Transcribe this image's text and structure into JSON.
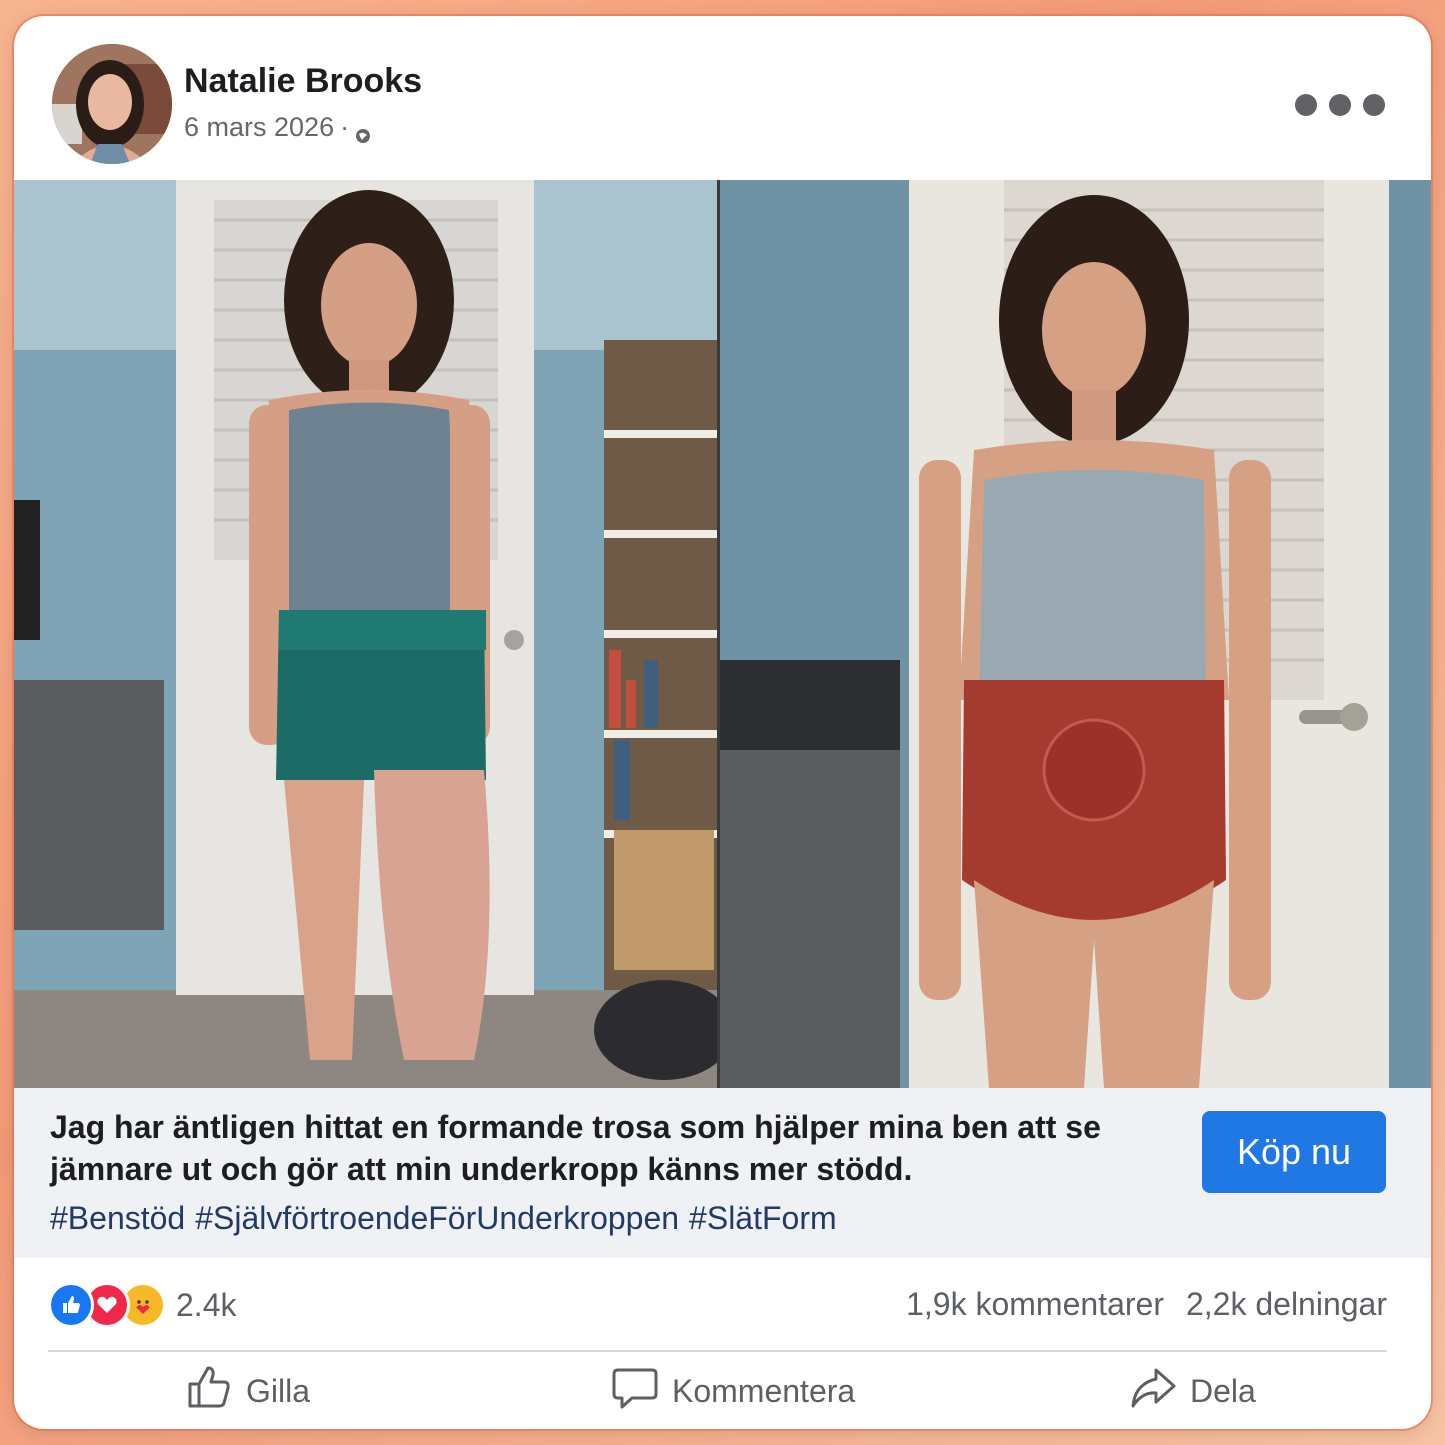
{
  "post": {
    "author": "Natalie Brooks",
    "date": "6 mars 2026",
    "separator": "·",
    "caption": "Jag har äntligen hittat en formande trosa som hjälper mina ben att se jämnare ut och gör att min underkropp känns mer stödd.",
    "hashtags": [
      "#Benstöd",
      "#SjälvförtroendeFörUnderkroppen",
      "#SlätForm"
    ],
    "cta_label": "Köp nu"
  },
  "stats": {
    "reaction_count": "2.4k",
    "comments": "1,9k kommentarer",
    "shares": "2,2k delningar"
  },
  "actions": {
    "like": "Gilla",
    "comment": "Kommentera",
    "share": "Dela"
  },
  "colors": {
    "accent": "#1f78e4",
    "hashtag": "#233a66",
    "like": "#1877f2",
    "love": "#f02849",
    "care": "#f7b928"
  },
  "icons": [
    "more-options-icon",
    "globe-icon",
    "like-reaction-icon",
    "love-reaction-icon",
    "care-reaction-icon",
    "thumbs-up-icon",
    "comment-icon",
    "share-icon"
  ]
}
